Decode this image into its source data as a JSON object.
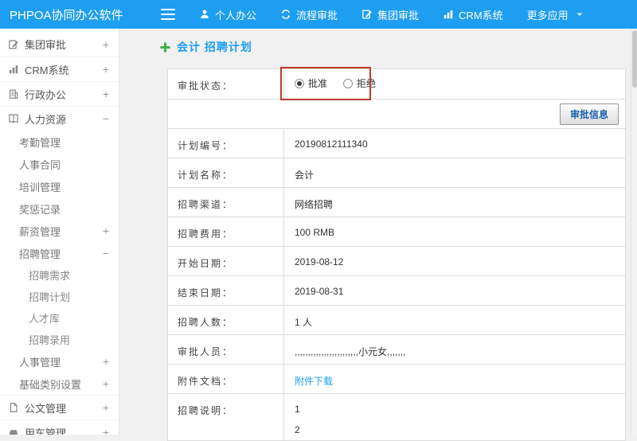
{
  "topbar": {
    "brand": "PHPOA协同办公软件",
    "menu": [
      {
        "key": "personal-office",
        "label": "个人办公",
        "icon": "person-icon"
      },
      {
        "key": "workflow-approval",
        "label": "流程审批",
        "icon": "workflow-icon"
      },
      {
        "key": "group-approval",
        "label": "集团审批",
        "icon": "edit-doc-icon"
      },
      {
        "key": "crm-system",
        "label": "CRM系统",
        "icon": "bar-chart-icon"
      },
      {
        "key": "more-apps",
        "label": "更多应用",
        "icon": null,
        "caret": true
      }
    ]
  },
  "sidebar": {
    "items": [
      {
        "key": "group-approval",
        "label": "集团审批",
        "level": 0,
        "icon": "edit-doc-icon",
        "expander": "+"
      },
      {
        "key": "crm-system",
        "label": "CRM系统",
        "level": 0,
        "icon": "bar-chart-icon",
        "expander": "+"
      },
      {
        "key": "admin-office",
        "label": "行政办公",
        "level": 0,
        "icon": "office-icon",
        "expander": "+"
      },
      {
        "key": "human-resources",
        "label": "人力资源",
        "level": 0,
        "icon": "hr-icon",
        "expander": "−"
      },
      {
        "key": "attendance",
        "label": "考勤管理",
        "level": 1
      },
      {
        "key": "hr-contract",
        "label": "人事合同",
        "level": 1
      },
      {
        "key": "training",
        "label": "培训管理",
        "level": 1
      },
      {
        "key": "rewards",
        "label": "奖惩记录",
        "level": 1
      },
      {
        "key": "salary",
        "label": "薪资管理",
        "level": 1,
        "expander": "+"
      },
      {
        "key": "recruitment",
        "label": "招聘管理",
        "level": 1,
        "expander": "−"
      },
      {
        "key": "recruit-demand",
        "label": "招聘需求",
        "level": 2
      },
      {
        "key": "recruit-plan",
        "label": "招聘计划",
        "level": 2
      },
      {
        "key": "talent-pool",
        "label": "人才库",
        "level": 2
      },
      {
        "key": "recruit-hire",
        "label": "招聘录用",
        "level": 2
      },
      {
        "key": "personnel",
        "label": "人事管理",
        "level": 1,
        "expander": "+"
      },
      {
        "key": "base-category",
        "label": "基础类别设置",
        "level": 1,
        "expander": "+"
      },
      {
        "key": "document-mgmt",
        "label": "公文管理",
        "level": 0,
        "icon": "doc-icon",
        "expander": "+"
      },
      {
        "key": "vehicle-mgmt",
        "label": "用车管理",
        "level": 0,
        "icon": "car-icon",
        "expander": "+"
      }
    ]
  },
  "content": {
    "title": "会计 招聘计划",
    "status": {
      "label": "审批状态：",
      "options": [
        {
          "key": "approve",
          "label": "批准",
          "checked": true
        },
        {
          "key": "reject",
          "label": "拒绝",
          "checked": false
        }
      ]
    },
    "toolbar": {
      "approve_button": "审批信息"
    },
    "rows": [
      {
        "label": "计划编号：",
        "value": "20190812111340"
      },
      {
        "label": "计划名称：",
        "value": "会计"
      },
      {
        "label": "招聘渠道：",
        "value": "网络招聘"
      },
      {
        "label": "招聘费用：",
        "value": "100 RMB"
      },
      {
        "label": "开始日期：",
        "value": "2019-08-12"
      },
      {
        "label": "结束日期：",
        "value": "2019-08-31"
      },
      {
        "label": "招聘人数：",
        "value": "1 人"
      },
      {
        "label": "审批人员：",
        "value": ",,,,,,,,,,,,,,,,,,,,,,,,小元女,,,,,,,"
      },
      {
        "label": "附件文档：",
        "value": "附件下载",
        "type": "link"
      },
      {
        "label": "招聘说明：",
        "value": "1\n2",
        "type": "multiline"
      }
    ],
    "colors": {
      "accent_blue": "#1d9ef0",
      "annotation_red": "#bf3b2b",
      "plus_green": "#3cb24a"
    }
  }
}
